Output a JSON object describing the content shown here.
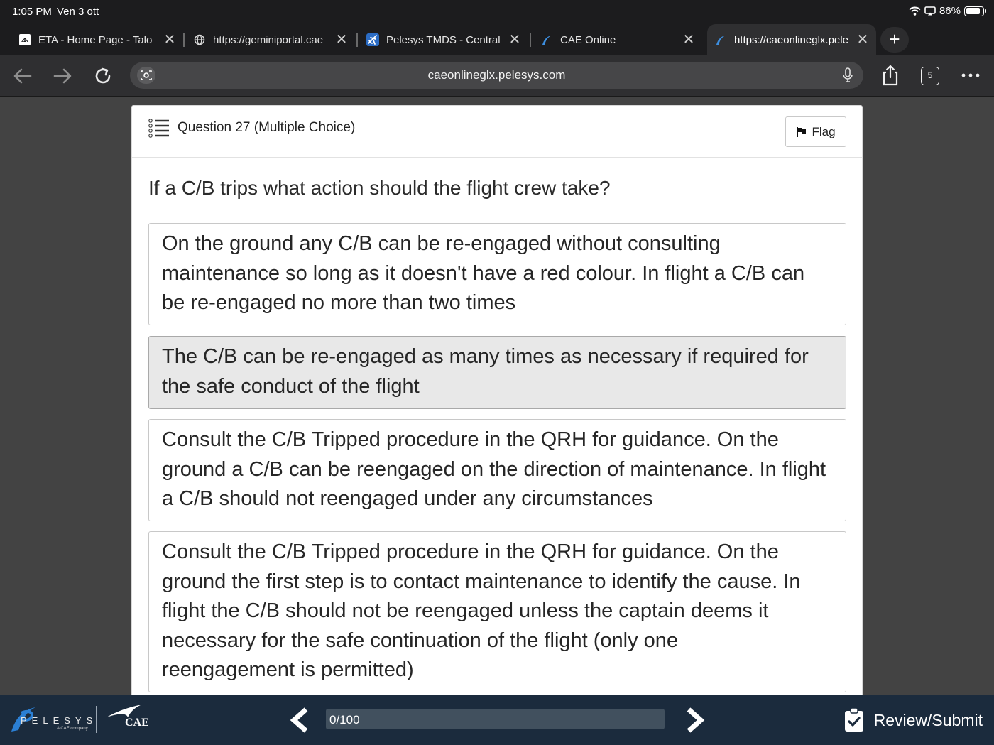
{
  "status_bar": {
    "time": "1:05 PM",
    "date": "Ven 3 ott",
    "battery": "86%"
  },
  "tabs": [
    {
      "label": "ETA - Home Page - Talon",
      "icon": "home-icon"
    },
    {
      "label": "https://geminiportal.cae",
      "icon": "globe-icon"
    },
    {
      "label": "Pelesys TMDS - Central",
      "icon": "plane-icon"
    },
    {
      "label": "CAE Online",
      "icon": "pelesys-icon"
    },
    {
      "label": "https://caeonlineglx.pele",
      "icon": "pelesys-icon"
    }
  ],
  "toolbar": {
    "url": "caeonlineglx.pelesys.com",
    "tab_count": "5"
  },
  "question": {
    "header": "Question 27 (Multiple Choice)",
    "flag_label": "Flag",
    "text": "If a C/B trips what action should the flight crew take?",
    "options": [
      "On the ground any C/B can be re-engaged without consulting maintenance so long as it doesn't have a red colour. In flight a C/B can be re-engaged no more than two times",
      "The C/B can be re-engaged as many times as necessary if required for the safe conduct of the flight",
      "Consult the C/B Tripped procedure in the QRH for guidance. On the ground a C/B can be reengaged on the direction of maintenance. In flight a C/B should not reengaged under any circumstances",
      "Consult the C/B Tripped procedure in the QRH for guidance. On the ground the first step is to contact maintenance to identify the cause. In flight the C/B should not be reengaged unless the captain deems it necessary for the safe continuation of the flight (only one reengagement is permitted)"
    ]
  },
  "bottom_bar": {
    "brand_pelesys": "PELESYS",
    "brand_pelesys_sub": "A CAE company",
    "brand_cae": "CAE",
    "progress_text": "0/100",
    "progress_fraction": 0,
    "review_label": "Review/Submit"
  }
}
